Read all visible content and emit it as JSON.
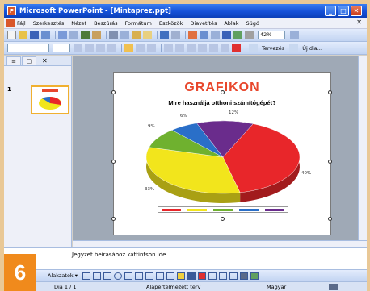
{
  "window": {
    "title": "Microsoft PowerPoint - [Mintaprez.ppt]",
    "min_label": "_",
    "max_label": "□",
    "close_label": "✕"
  },
  "menu": {
    "items": [
      "Fájl",
      "Szerkesztés",
      "Nézet",
      "Beszúrás",
      "Formátum",
      "Eszközök",
      "Diavetítés",
      "Ablak",
      "Súgó"
    ],
    "close_label": "✕"
  },
  "toolbar": {
    "zoom": "42%",
    "new_slide_label": "Tervezés",
    "design_label": "Új dia..."
  },
  "outline_tabs": {
    "close_label": "✕"
  },
  "slide_panel": {
    "slide_number": "1"
  },
  "slide": {
    "title": "GRAFIKON",
    "chart_title": "Mire használja otthoni számítógépét?"
  },
  "chart_data": {
    "type": "pie",
    "title": "Mire használja otthoni számítógépét?",
    "slices": [
      {
        "label": "12%",
        "value": 12,
        "color": "#6a2c8c"
      },
      {
        "label": "40%",
        "value": 40,
        "color": "#e8262a"
      },
      {
        "label": "33%",
        "value": 33,
        "color": "#f2e51c"
      },
      {
        "label": "9%",
        "value": 9,
        "color": "#6fb12f"
      },
      {
        "label": "6%",
        "value": 6,
        "color": "#2a6fc8"
      }
    ],
    "legend_colors": [
      "#e8262a",
      "#f2e51c",
      "#6fb12f",
      "#2a6fc8",
      "#6a2c8c"
    ]
  },
  "notes": {
    "placeholder": "Jegyzet beírásához kattintson ide"
  },
  "drawing_toolbar": {
    "autoshapes_label": "Alakzatok ▾"
  },
  "status": {
    "slide": "Dia 1 / 1",
    "design": "Alapértelmezett terv",
    "language": "Magyar"
  },
  "badge": {
    "number": "6"
  }
}
